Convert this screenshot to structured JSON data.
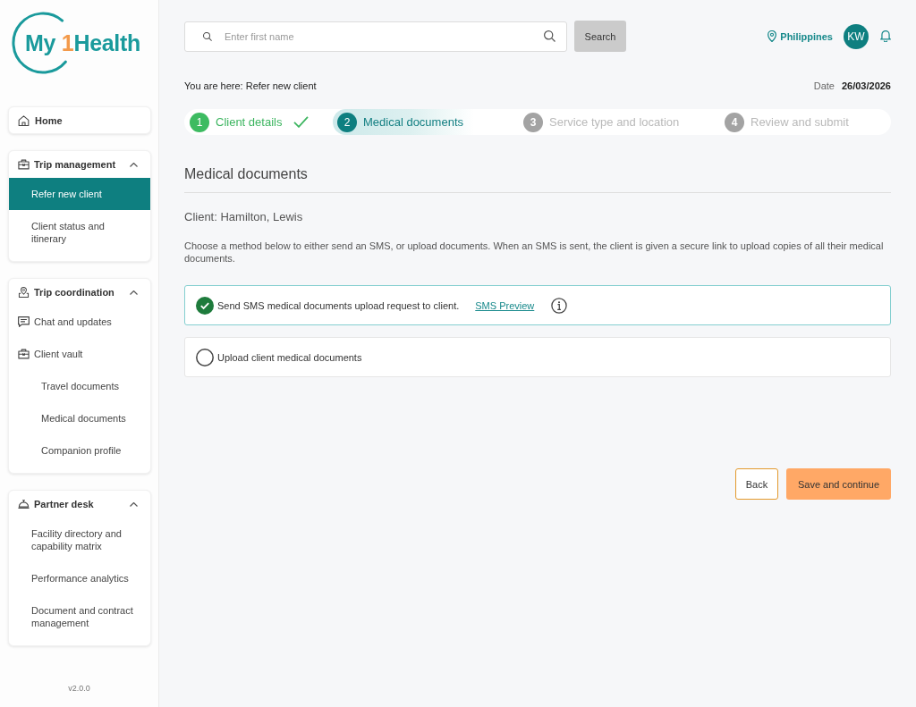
{
  "logo": {
    "prefix": "My",
    "accent": "1",
    "suffix": "Health"
  },
  "sidebar": {
    "home": {
      "label": "Home",
      "selected": false
    },
    "sections": [
      {
        "title": "Trip management",
        "expanded": true,
        "items": [
          {
            "label": "Refer new client",
            "selected": true
          },
          {
            "label": "Client status and itinerary",
            "selected": false
          }
        ]
      },
      {
        "title": "Trip coordination",
        "expanded": true,
        "items": [
          {
            "label": "Chat and updates",
            "selected": false
          },
          {
            "label": "Client vault",
            "selected": false,
            "children": [
              {
                "label": "Travel documents",
                "selected": false
              },
              {
                "label": "Medical documents",
                "selected": false
              },
              {
                "label": "Companion profile",
                "selected": false
              }
            ]
          }
        ]
      },
      {
        "title": "Partner desk",
        "expanded": true,
        "items": [
          {
            "label": "Facility directory and capability matrix",
            "selected": false
          },
          {
            "label": "Performance analytics",
            "selected": false
          },
          {
            "label": "Document and contract management",
            "selected": false
          }
        ]
      }
    ],
    "version": "v2.0.0"
  },
  "header": {
    "search": {
      "placeholder": "Enter first name",
      "button": "Search"
    },
    "location": "Philippines",
    "avatar": "KW"
  },
  "breadcrumb": {
    "label": "You are here: Refer new client",
    "date_label": "Date",
    "date": "26/03/2026"
  },
  "stepper": [
    {
      "number": "1",
      "label": "Client details",
      "completed": true,
      "selected": false
    },
    {
      "number": "2",
      "label": "Medical documents",
      "completed": false,
      "selected": true
    },
    {
      "number": "3",
      "label": "Service type and location",
      "completed": false,
      "selected": false
    },
    {
      "number": "4",
      "label": "Review and submit",
      "completed": false,
      "selected": false
    }
  ],
  "section_title": "Medical documents",
  "client": "Client: Hamilton, Lewis",
  "instructions": "Choose a method below to either send an SMS, or upload documents. When an SMS is sent, the client is given a secure link to upload copies of all their medical documents.",
  "options": [
    {
      "label": "Send SMS medical documents upload request to client.",
      "selected": true,
      "link": "SMS Preview"
    },
    {
      "label": "Upload client medical documents",
      "selected": false
    }
  ],
  "buttons": {
    "back": "Back",
    "primary": "Save and continue"
  }
}
